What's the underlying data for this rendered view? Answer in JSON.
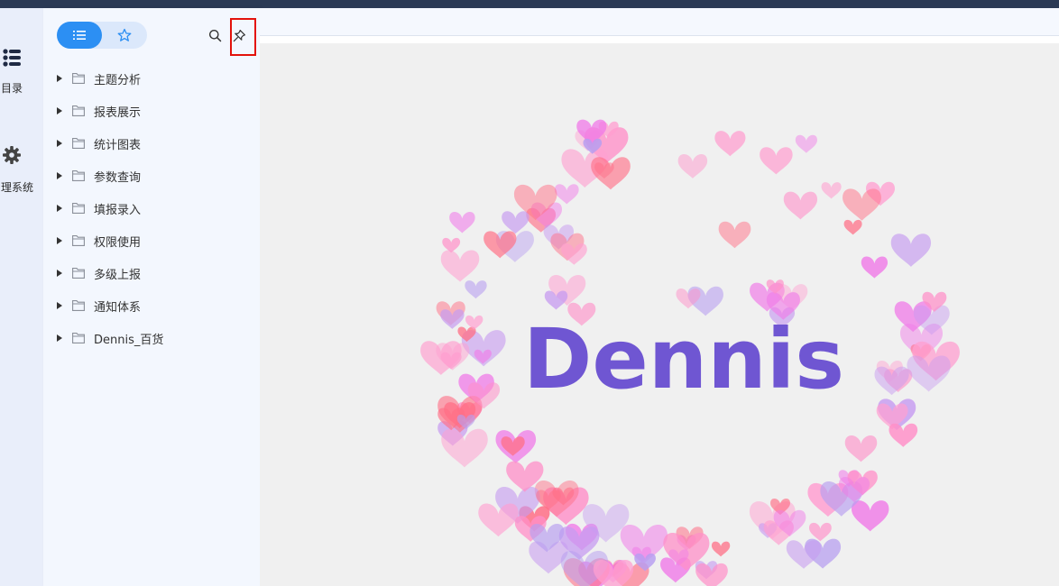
{
  "leftnav": {
    "items": [
      {
        "label": "目录",
        "icon": "list-icon"
      },
      {
        "label": "理系统",
        "icon": "gear-icon"
      }
    ]
  },
  "panel": {
    "tabs": [
      {
        "name": "list-view",
        "icon": "list-icon",
        "active": true
      },
      {
        "name": "favorites",
        "icon": "star-icon",
        "active": false
      }
    ],
    "tools": [
      {
        "icon": "search-icon"
      },
      {
        "icon": "pin-icon",
        "highlighted": true
      }
    ]
  },
  "tree": {
    "items": [
      {
        "label": "主题分析"
      },
      {
        "label": "报表展示"
      },
      {
        "label": "统计图表"
      },
      {
        "label": "参数查询"
      },
      {
        "label": "填报录入"
      },
      {
        "label": "权限使用"
      },
      {
        "label": "多级上报"
      },
      {
        "label": "通知体系"
      },
      {
        "label": "Dennis_百货"
      }
    ]
  },
  "main": {
    "wordmark": "Dennis",
    "wordmark_color": "#6f56d2",
    "heart_colors": [
      "#ff6f86",
      "#ff8fc8",
      "#f07be8",
      "#c79cf0",
      "#b79ef0",
      "#ff9fd0"
    ]
  },
  "colors": {
    "topbar": "#2b3a55",
    "accent": "#2c8ff3",
    "highlight": "#e3120b"
  }
}
